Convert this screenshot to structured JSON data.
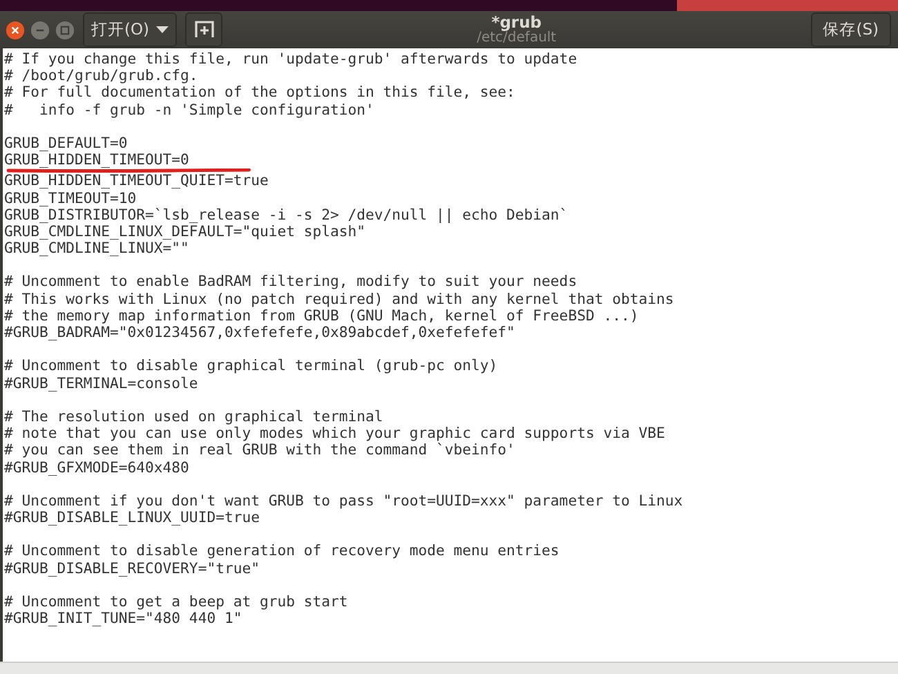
{
  "window": {
    "title": "*grub",
    "subtitle": "/etc/default"
  },
  "header": {
    "open_button": "打开(O)",
    "save_button": "保存(S)"
  },
  "editor": {
    "blocks": [
      [
        "# If you change this file, run 'update-grub' afterwards to update",
        "# /boot/grub/grub.cfg.",
        "# For full documentation of the options in this file, see:",
        "#   info -f grub -n 'Simple configuration'"
      ],
      [
        "GRUB_DEFAULT=0",
        "GRUB_HIDDEN_TIMEOUT=0",
        "GRUB_HIDDEN_TIMEOUT_QUIET=true",
        "GRUB_TIMEOUT=10",
        "GRUB_DISTRIBUTOR=`lsb_release -i -s 2> /dev/null || echo Debian`",
        "GRUB_CMDLINE_LINUX_DEFAULT=\"quiet splash\"",
        "GRUB_CMDLINE_LINUX=\"\""
      ],
      [
        "# Uncomment to enable BadRAM filtering, modify to suit your needs",
        "# This works with Linux (no patch required) and with any kernel that obtains",
        "# the memory map information from GRUB (GNU Mach, kernel of FreeBSD ...)",
        "#GRUB_BADRAM=\"0x01234567,0xfefefefe,0x89abcdef,0xefefefef\""
      ],
      [
        "# Uncomment to disable graphical terminal (grub-pc only)",
        "#GRUB_TERMINAL=console"
      ],
      [
        "# The resolution used on graphical terminal",
        "# note that you can use only modes which your graphic card supports via VBE",
        "# you can see them in real GRUB with the command `vbeinfo'",
        "#GRUB_GFXMODE=640x480"
      ],
      [
        "# Uncomment if you don't want GRUB to pass \"root=UUID=xxx\" parameter to Linux",
        "#GRUB_DISABLE_LINUX_UUID=true"
      ],
      [
        "# Uncomment to disable generation of recovery mode menu entries",
        "#GRUB_DISABLE_RECOVERY=\"true\""
      ],
      [
        "# Uncomment to get a beep at grub start",
        "#GRUB_INIT_TUNE=\"480 440 1\""
      ]
    ]
  }
}
